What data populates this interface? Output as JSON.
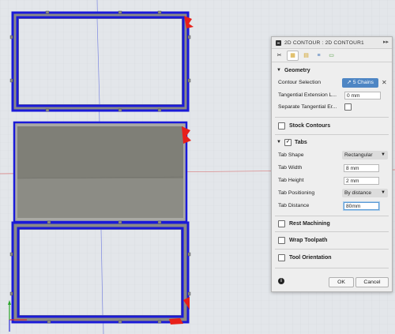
{
  "panel": {
    "title": "2D CONTOUR : 2D CONTOUR1",
    "collapse_glyph": "▸▸",
    "toolbar_tabs": [
      {
        "icon": "tool-icon",
        "glyph": "✂"
      },
      {
        "icon": "geometry-icon",
        "glyph": "▦"
      },
      {
        "icon": "heights-icon",
        "glyph": "▤"
      },
      {
        "icon": "passes-icon",
        "glyph": "≡"
      },
      {
        "icon": "linking-icon",
        "glyph": "▭"
      }
    ],
    "geometry": {
      "header": "Geometry",
      "contour_selection_label": "Contour Selection",
      "chains_label": "5 Chains",
      "clear_glyph": "✕",
      "tangential_extension_label": "Tangential Extension L...",
      "tangential_extension_value": "0 mm",
      "separate_tangential_label": "Separate Tangential Er...",
      "separate_tangential_checked": false
    },
    "stock_contours": {
      "label": "Stock Contours",
      "checked": false
    },
    "tabs": {
      "header": "Tabs",
      "checked": true,
      "check_glyph": "✓",
      "tab_shape_label": "Tab Shape",
      "tab_shape_value": "Rectangular",
      "tab_width_label": "Tab Width",
      "tab_width_value": "8 mm",
      "tab_height_label": "Tab Height",
      "tab_height_value": "2 mm",
      "tab_positioning_label": "Tab Positioning",
      "tab_positioning_value": "By distance",
      "tab_distance_label": "Tab Distance",
      "tab_distance_value": "80mm"
    },
    "rest_machining": {
      "label": "Rest Machining",
      "checked": false
    },
    "wrap_toolpath": {
      "label": "Wrap Toolpath",
      "checked": false
    },
    "tool_orientation": {
      "label": "Tool Orientation",
      "checked": false
    },
    "footer": {
      "info_glyph": "i",
      "ok_label": "OK",
      "cancel_label": "Cancel"
    }
  },
  "colors": {
    "background": "#e3e6ea",
    "chain_blue": "#1a1ad8",
    "start_marker": "#e8201a",
    "part_gray": "#7f7f77",
    "button_blue": "#4e86c4",
    "grid_red": "#d87a7a",
    "grid_blue": "#7b86e0"
  }
}
